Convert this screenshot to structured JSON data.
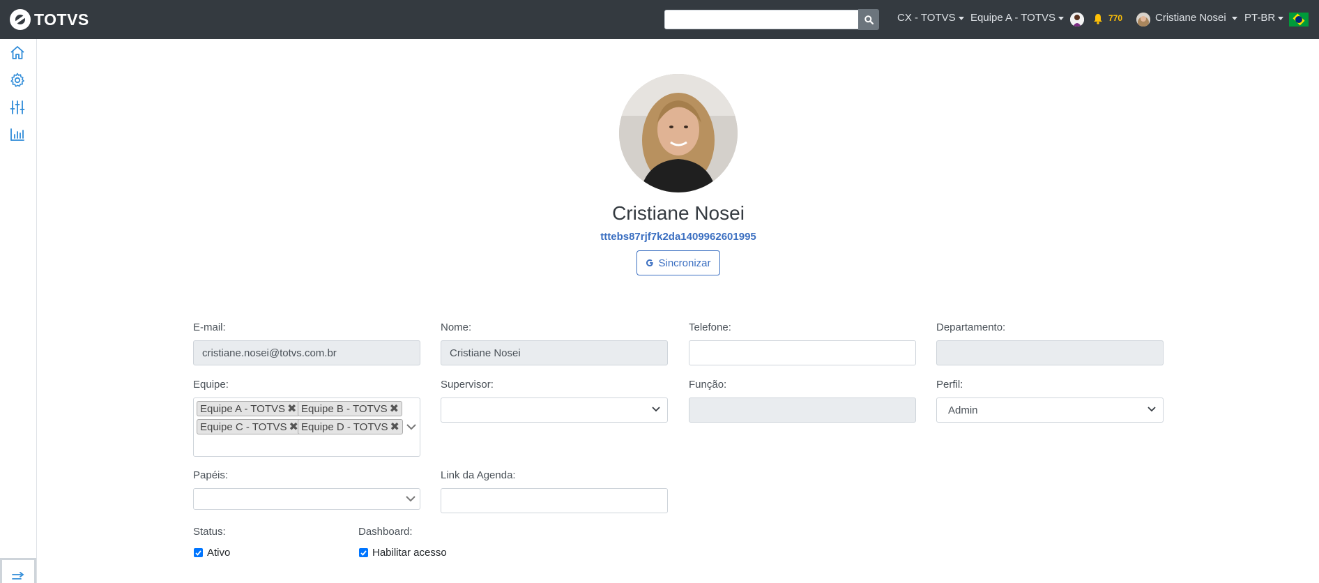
{
  "brand": {
    "name": "TOTVS"
  },
  "navbar": {
    "search_value": "",
    "company_menu": "CX - TOTVS",
    "team_menu": "Equipe A - TOTVS",
    "notification_count": "770",
    "user_menu": "Cristiane Nosei",
    "language_menu": "PT-BR"
  },
  "sidebar": {
    "items": [
      "home-icon",
      "gear-icon",
      "sliders-icon",
      "chart-icon"
    ],
    "toggle": "collapse-toggle-icon"
  },
  "profile": {
    "name": "Cristiane Nosei",
    "id": "tttebs87rjf7k2da1409962601995",
    "sync_label": "Sincronizar"
  },
  "form": {
    "email_label": "E-mail:",
    "email_value": "cristiane.nosei@totvs.com.br",
    "name_label": "Nome:",
    "name_value": "Cristiane Nosei",
    "phone_label": "Telefone:",
    "phone_value": "",
    "department_label": "Departamento:",
    "department_value": "",
    "team_label": "Equipe:",
    "teams": [
      "Equipe A - TOTVS",
      "Equipe B - TOTVS",
      "Equipe C - TOTVS",
      "Equipe D - TOTVS"
    ],
    "supervisor_label": "Supervisor:",
    "supervisor_value": "",
    "role_label": "Função:",
    "role_value": "",
    "profile_label": "Perfil:",
    "profile_value": "Admin",
    "papers_label": "Papéis:",
    "papers_value": "",
    "agenda_label": "Link da Agenda:",
    "agenda_value": "",
    "status_label": "Status:",
    "status_option": "Ativo",
    "status_checked": true,
    "dashboard_label": "Dashboard:",
    "dashboard_option": "Habilitar acesso",
    "dashboard_checked": true
  },
  "colors": {
    "navbar": "#343a40",
    "accent": "#3b6fc1",
    "sidebar_icon": "#2e8bd8",
    "badge": "#ffc107"
  }
}
